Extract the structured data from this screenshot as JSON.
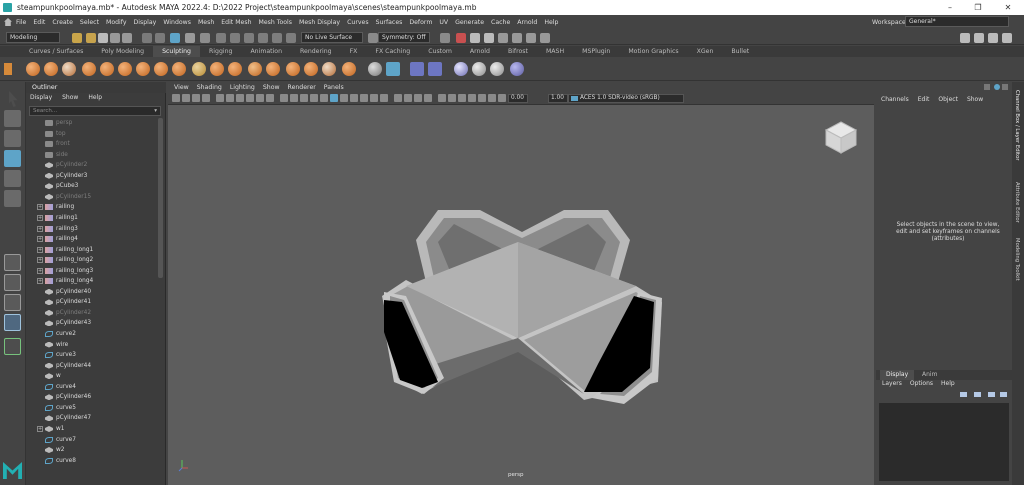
{
  "title_bar": {
    "tab_label": "steampunkpoolmaya.mb* - Autodesk MAYA 2022.4: D:\\2022 Project\\steampunkpoolmaya\\scenes\\steampunkpoolmaya.mb",
    "minimize": "–",
    "maximize": "❐",
    "close": "✕"
  },
  "menubar": {
    "items": [
      "File",
      "Edit",
      "Create",
      "Select",
      "Modify",
      "Display",
      "Windows",
      "Mesh",
      "Edit Mesh",
      "Mesh Tools",
      "Mesh Display",
      "Curves",
      "Surfaces",
      "Deform",
      "UV",
      "Generate",
      "Cache",
      "Arnold",
      "Help"
    ],
    "workspace_label": "Workspace:",
    "workspace_value": "General*"
  },
  "statusline": {
    "mode": "Modeling",
    "live_surface": "No Live Surface",
    "symmetry": "Symmetry: Off"
  },
  "shelf": {
    "tabs": [
      "Curves / Surfaces",
      "Poly Modeling",
      "Sculpting",
      "Rigging",
      "Animation",
      "Rendering",
      "FX",
      "FX Caching",
      "Custom",
      "Arnold",
      "Bifrost",
      "MASH",
      "MSPlugin",
      "Motion Graphics",
      "XGen",
      "Bullet"
    ],
    "active_tab": "Sculpting"
  },
  "outliner": {
    "title": "Outliner",
    "menu": [
      "Display",
      "Show",
      "Help"
    ],
    "search_placeholder": "Search...",
    "items": [
      {
        "name": "persp",
        "type": "camera",
        "dim": true,
        "expand": false
      },
      {
        "name": "top",
        "type": "camera",
        "dim": true,
        "expand": false
      },
      {
        "name": "front",
        "type": "camera",
        "dim": true,
        "expand": false
      },
      {
        "name": "side",
        "type": "camera",
        "dim": true,
        "expand": false
      },
      {
        "name": "pCylinder2",
        "type": "mesh",
        "dim": true,
        "expand": false
      },
      {
        "name": "pCylinder3",
        "type": "mesh",
        "dim": false,
        "expand": false
      },
      {
        "name": "pCube3",
        "type": "mesh",
        "dim": false,
        "expand": false
      },
      {
        "name": "pCylinder15",
        "type": "mesh",
        "dim": true,
        "expand": false
      },
      {
        "name": "railing",
        "type": "group",
        "dim": false,
        "expand": true
      },
      {
        "name": "railing1",
        "type": "group",
        "dim": false,
        "expand": true
      },
      {
        "name": "railing3",
        "type": "group",
        "dim": false,
        "expand": true
      },
      {
        "name": "railing4",
        "type": "group",
        "dim": false,
        "expand": true
      },
      {
        "name": "railing_long1",
        "type": "group",
        "dim": false,
        "expand": true
      },
      {
        "name": "railing_long2",
        "type": "group",
        "dim": false,
        "expand": true
      },
      {
        "name": "railing_long3",
        "type": "group",
        "dim": false,
        "expand": true
      },
      {
        "name": "railing_long4",
        "type": "group",
        "dim": false,
        "expand": true
      },
      {
        "name": "pCylinder40",
        "type": "mesh",
        "dim": false,
        "expand": false
      },
      {
        "name": "pCylinder41",
        "type": "mesh",
        "dim": false,
        "expand": false
      },
      {
        "name": "pCylinder42",
        "type": "mesh",
        "dim": true,
        "expand": false
      },
      {
        "name": "pCylinder43",
        "type": "mesh",
        "dim": false,
        "expand": false
      },
      {
        "name": "curve2",
        "type": "curve",
        "dim": false,
        "expand": false
      },
      {
        "name": "wire",
        "type": "mesh",
        "dim": false,
        "expand": false
      },
      {
        "name": "curve3",
        "type": "curve",
        "dim": false,
        "expand": false
      },
      {
        "name": "pCylinder44",
        "type": "mesh",
        "dim": false,
        "expand": false
      },
      {
        "name": "w",
        "type": "mesh",
        "dim": false,
        "expand": false
      },
      {
        "name": "curve4",
        "type": "curve",
        "dim": false,
        "expand": false
      },
      {
        "name": "pCylinder46",
        "type": "mesh",
        "dim": false,
        "expand": false
      },
      {
        "name": "curve5",
        "type": "curve",
        "dim": false,
        "expand": false
      },
      {
        "name": "pCylinder47",
        "type": "mesh",
        "dim": false,
        "expand": false
      },
      {
        "name": "w1",
        "type": "mesh",
        "dim": false,
        "expand": true
      },
      {
        "name": "curve7",
        "type": "curve",
        "dim": false,
        "expand": false
      },
      {
        "name": "w2",
        "type": "mesh",
        "dim": false,
        "expand": false
      },
      {
        "name": "curve8",
        "type": "curve",
        "dim": false,
        "expand": false
      }
    ]
  },
  "viewport": {
    "menu": [
      "View",
      "Shading",
      "Lighting",
      "Show",
      "Renderer",
      "Panels"
    ],
    "exposure": "0.00",
    "gamma": "1.00",
    "colorspace": "ACES 1.0 SDR-video (sRGB)",
    "camera_label": "persp"
  },
  "channel_box": {
    "menu": [
      "Channels",
      "Edit",
      "Object",
      "Show"
    ],
    "empty_message": "Select objects in the scene to view, edit and set keyframes on channels (attributes)"
  },
  "layer_editor": {
    "tabs": [
      "Display",
      "Anim"
    ],
    "active_tab": "Display",
    "menu": [
      "Layers",
      "Options",
      "Help"
    ]
  },
  "side_tabs": [
    "Channel Box / Layer Editor",
    "Attribute Editor",
    "Modeling Toolkit"
  ],
  "colors": {
    "accent": "#5ea4c8",
    "viewport_bg": "#5d5d5d",
    "panel_bg": "#444444"
  }
}
